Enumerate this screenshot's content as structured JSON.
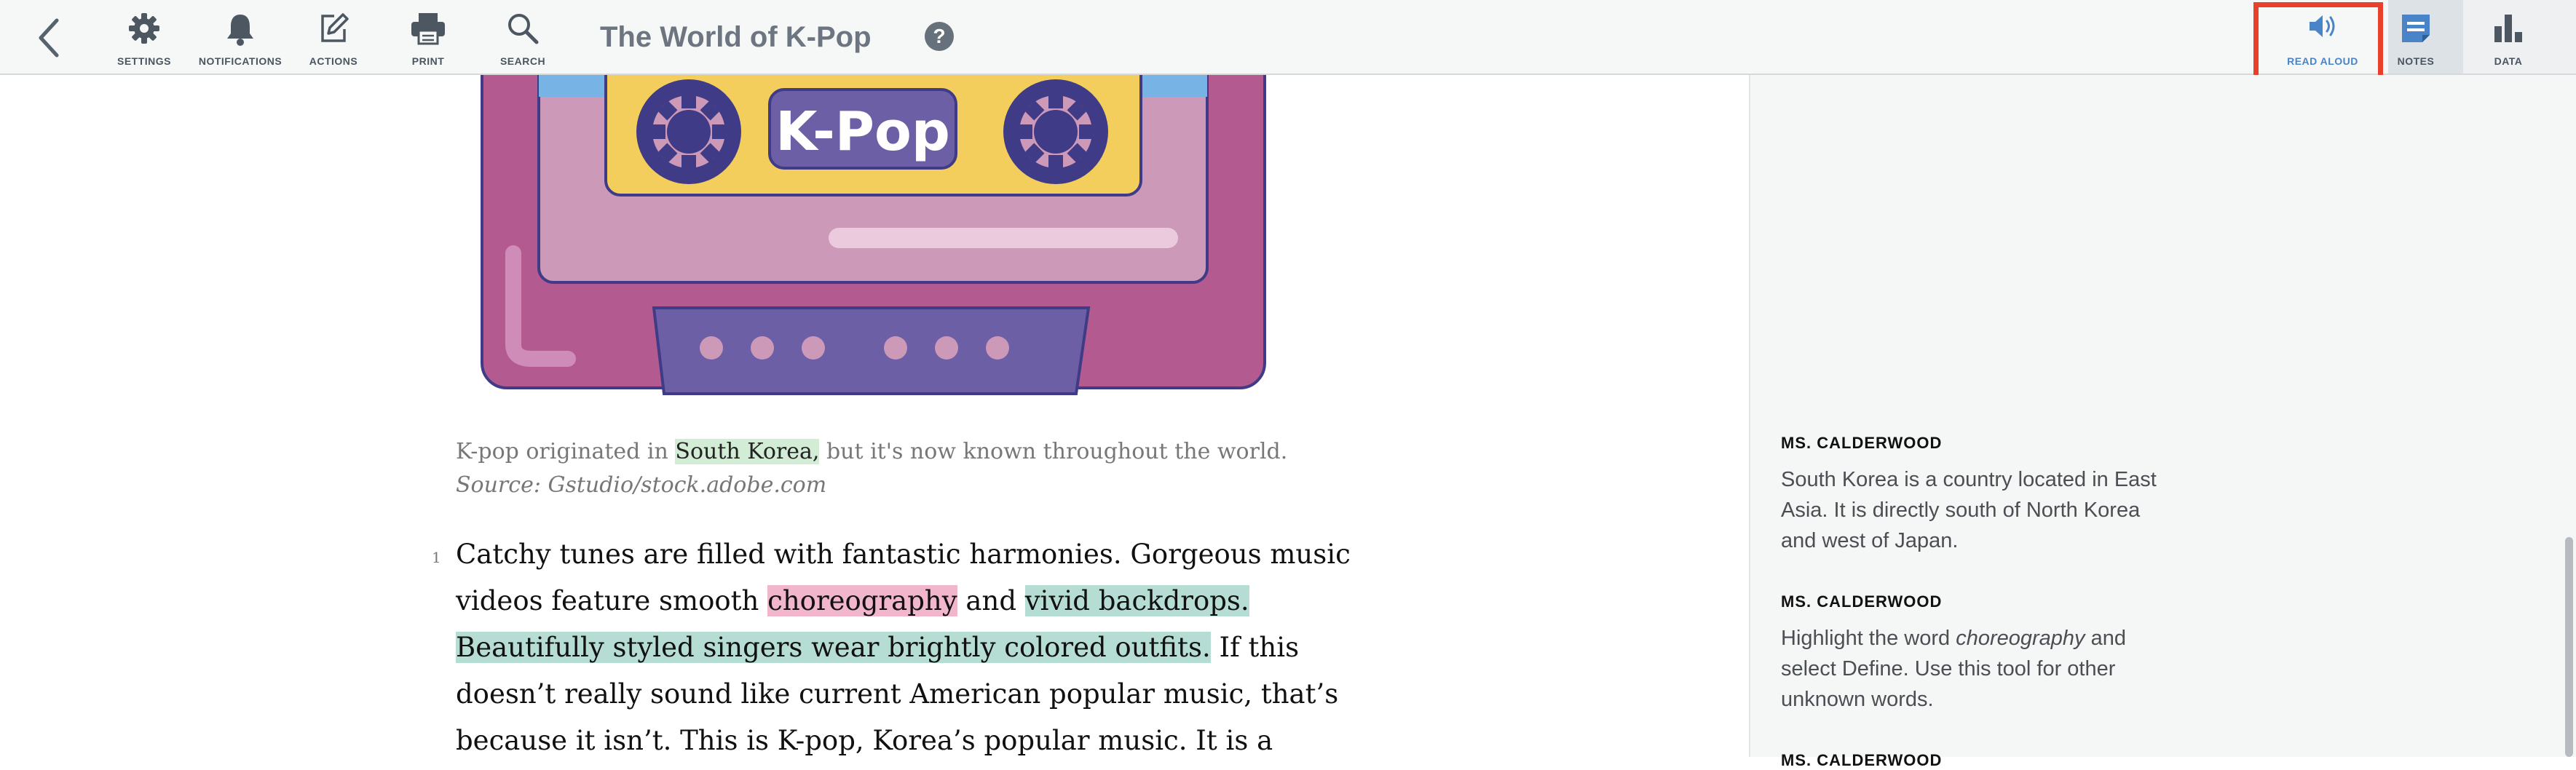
{
  "toolbar": {
    "title": "The World of K-Pop",
    "help_symbol": "?",
    "buttons": {
      "settings": "SETTINGS",
      "notifications": "NOTIFICATIONS",
      "actions": "ACTIONS",
      "print": "PRINT",
      "search": "SEARCH",
      "read_aloud": "READ ALOUD",
      "notes": "NOTES",
      "data": "DATA"
    },
    "icons": [
      "back-chevron-icon",
      "gear-icon",
      "bell-icon",
      "edit-icon",
      "printer-icon",
      "search-icon",
      "speaker-icon",
      "notes-icon",
      "bar-chart-icon"
    ]
  },
  "article": {
    "illustration_text": "K-Pop",
    "caption": {
      "pre": "K-pop originated in ",
      "highlight": "South Korea,",
      "post": " but it's now known throughout the world.",
      "source": "Source: Gstudio/stock.adobe.com"
    },
    "paragraph_number": "1",
    "lines": [
      {
        "t1": "Catchy tunes are filled with fantastic harmonies. Gorgeous music"
      },
      {
        "t1": "videos feature smooth ",
        "pink": "choreography",
        "t2": " and ",
        "teal": "vivid backdrops."
      },
      {
        "teal": "Beautifully styled singers wear brightly colored outfits.",
        "t2": " If this"
      },
      {
        "t1": "doesn’t really sound like current American popular music, that’s"
      },
      {
        "t1": "because it isn’t. This is K-pop, Korea’s popular music. It is a"
      }
    ]
  },
  "notes": [
    {
      "author": "MS. CALDERWOOD",
      "lines": [
        "South Korea is a country located in East",
        "Asia. It is directly south of North Korea",
        "and west of Japan."
      ]
    },
    {
      "author": "MS. CALDERWOOD",
      "line1_pre": "Highlight the word ",
      "line1_em": "choreography",
      "line1_post": " and",
      "lines": [
        "select Define. Use this tool for other",
        "unknown words."
      ]
    },
    {
      "author": "MS. CALDERWOOD"
    }
  ],
  "colors": {
    "annotation_red": "#e8402b",
    "active_blue": "#4a84c8",
    "highlight_pink": "#f1b6cc",
    "highlight_teal": "#b6ddd4",
    "highlight_green": "#d3ecd5"
  }
}
